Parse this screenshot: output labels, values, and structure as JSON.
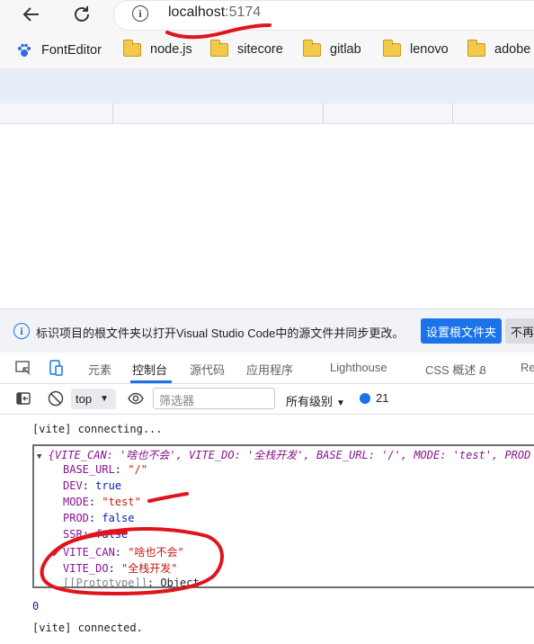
{
  "browser": {
    "address_host": "localhost",
    "address_port": ":5174",
    "address_info_glyph": "i"
  },
  "bookmarks": [
    "FontEditor",
    "node.js",
    "sitecore",
    "gitlab",
    "lenovo",
    "adobe"
  ],
  "infobar": {
    "text": "标识项目的根文件夹以打开Visual Studio Code中的源文件并同步更改。",
    "primary_button": "设置根文件夹",
    "secondary_button": "不再"
  },
  "devtools_tabs": [
    "元素",
    "控制台",
    "源代码",
    "应用程序",
    "Lighthouse",
    "CSS 概述",
    "Re"
  ],
  "devtools_active_tab": "控制台",
  "console_toolbar": {
    "context": "top",
    "filter_placeholder": "筛选器",
    "levels": "所有级别",
    "message_count": "21"
  },
  "console": {
    "line1": "[vite] connecting...",
    "object_summary": "{VITE_CAN: '啥也不会', VITE_DO: '全栈开发', BASE_URL: '/', MODE: 'test', PROD",
    "props": [
      {
        "key": "BASE_URL",
        "value": "\"/\"",
        "type": "str"
      },
      {
        "key": "DEV",
        "value": "true",
        "type": "kw"
      },
      {
        "key": "MODE",
        "value": "\"test\"",
        "type": "str"
      },
      {
        "key": "PROD",
        "value": "false",
        "type": "kw"
      },
      {
        "key": "SSR",
        "value": "false",
        "type": "kw"
      },
      {
        "key": "VITE_CAN",
        "value": "\"啥也不会\"",
        "type": "str"
      },
      {
        "key": "VITE_DO",
        "value": "\"全栈开发\"",
        "type": "str"
      },
      {
        "key": "[[Prototype]]",
        "value": "Object",
        "type": "plain"
      }
    ],
    "zero_line": "0",
    "last_line": "[vite] connected."
  },
  "colors": {
    "accent": "#1a73e8",
    "annotation_red": "#e0141e"
  }
}
